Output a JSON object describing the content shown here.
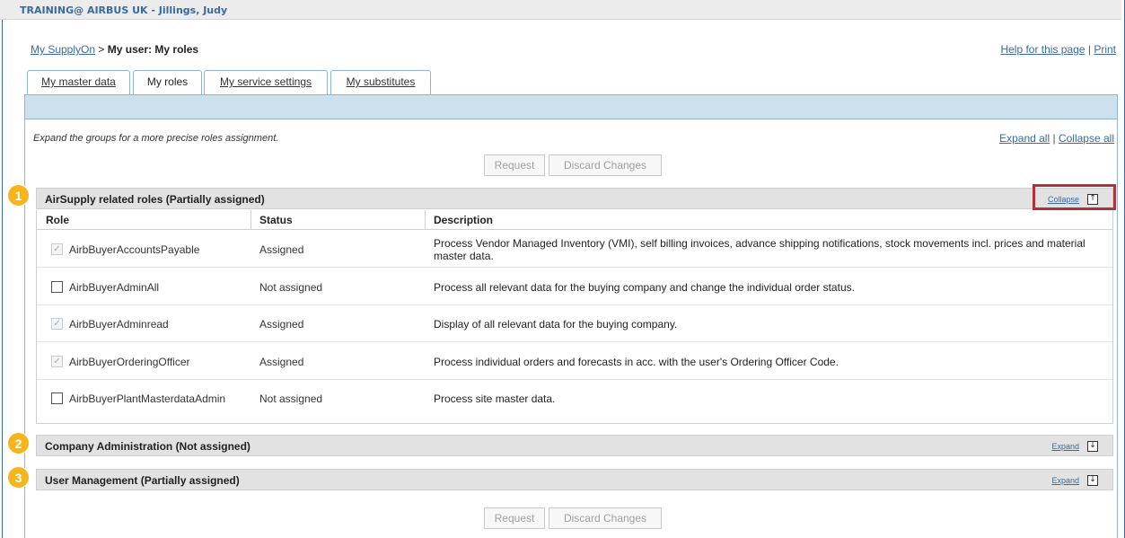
{
  "header": {
    "title": "TRAINING@ AIRBUS UK - Jillings, Judy"
  },
  "breadcrumb": {
    "root": "My SupplyOn",
    "separator": ">",
    "current": "My user: My roles"
  },
  "toplinks": {
    "help": "Help for this page",
    "divider": "|",
    "print": "Print"
  },
  "tabs": [
    {
      "label": "My master data",
      "active": false
    },
    {
      "label": "My roles",
      "active": true
    },
    {
      "label": "My service settings",
      "active": false
    },
    {
      "label": "My substitutes",
      "active": false
    }
  ],
  "main": {
    "hint": "Expand the groups for a more precise roles assignment.",
    "expand_all": "Expand all",
    "divider": "|",
    "collapse_all": "Collapse all",
    "request_label": "Request",
    "discard_label": "Discard Changes"
  },
  "groups": [
    {
      "badge": "1",
      "title": "AirSupply related roles (Partially assigned)",
      "action": "Collapse",
      "icon": "collapse-up-icon",
      "icon_glyph": "↑"
    },
    {
      "badge": "2",
      "title": "Company Administration (Not assigned)",
      "action": "Expand",
      "icon": "expand-down-icon",
      "icon_glyph": "↓"
    },
    {
      "badge": "3",
      "title": "User Management (Partially assigned)",
      "action": "Expand",
      "icon": "expand-down-icon",
      "icon_glyph": "↓"
    }
  ],
  "table": {
    "headers": {
      "role": "Role",
      "status": "Status",
      "description": "Description"
    },
    "rows": [
      {
        "role": "AirbBuyerAccountsPayable",
        "status": "Assigned",
        "checked": true,
        "description": "Process Vendor Managed Inventory (VMI), self billing invoices, advance shipping notifications, stock movements incl. prices and material master data."
      },
      {
        "role": "AirbBuyerAdminAll",
        "status": "Not assigned",
        "checked": false,
        "description": "Process all relevant data for the buying company and change the individual order status."
      },
      {
        "role": "AirbBuyerAdminread",
        "status": "Assigned",
        "checked": true,
        "description": "Display of all relevant data for the buying company."
      },
      {
        "role": "AirbBuyerOrderingOfficer",
        "status": "Assigned",
        "checked": true,
        "description": "Process individual orders and forecasts in acc. with the user's Ordering Officer Code."
      },
      {
        "role": "AirbBuyerPlantMasterdataAdmin",
        "status": "Not assigned",
        "checked": false,
        "description": "Process site master data."
      }
    ]
  },
  "colors": {
    "link": "#3a6aa0",
    "badge": "#f6b51b",
    "highlight": "#b1303a",
    "tabbar": "#cde0ee"
  }
}
